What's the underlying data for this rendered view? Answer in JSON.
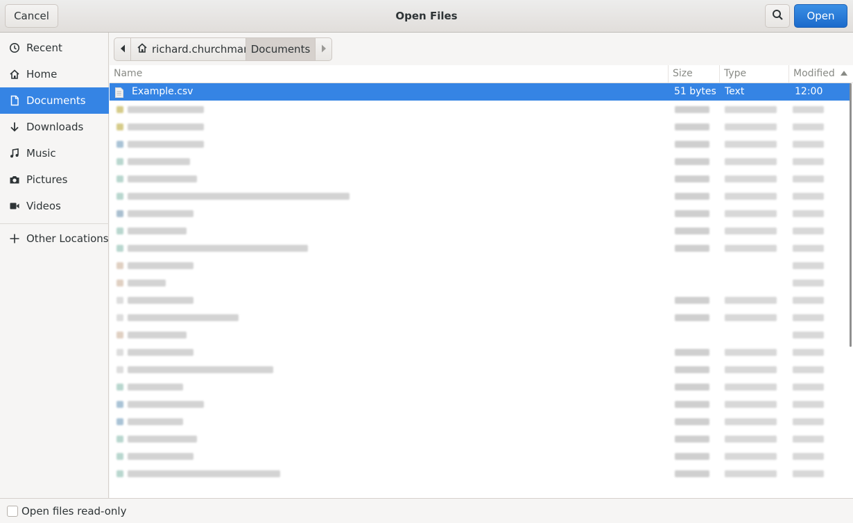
{
  "header": {
    "title": "Open Files",
    "cancel_label": "Cancel",
    "open_label": "Open"
  },
  "sidebar": {
    "items": [
      {
        "label": "Recent",
        "icon": "clock-icon"
      },
      {
        "label": "Home",
        "icon": "home-icon"
      },
      {
        "label": "Documents",
        "icon": "document-icon"
      },
      {
        "label": "Downloads",
        "icon": "download-icon"
      },
      {
        "label": "Music",
        "icon": "music-icon"
      },
      {
        "label": "Pictures",
        "icon": "camera-icon"
      },
      {
        "label": "Videos",
        "icon": "video-icon"
      }
    ],
    "other_locations": "Other Locations"
  },
  "pathbar": {
    "home": "richard.churchman",
    "current": "Documents"
  },
  "columns": {
    "name": "Name",
    "size": "Size",
    "type": "Type",
    "modified": "Modified"
  },
  "selected_file": {
    "name": "Example.csv",
    "size": "51 bytes",
    "type": "Text",
    "modified": "12:00"
  },
  "footer": {
    "read_only_label": "Open files read-only"
  },
  "colors": {
    "accent": "#3584e4",
    "sidebar_bg": "#f6f5f4",
    "list_bg": "#ffffff"
  }
}
